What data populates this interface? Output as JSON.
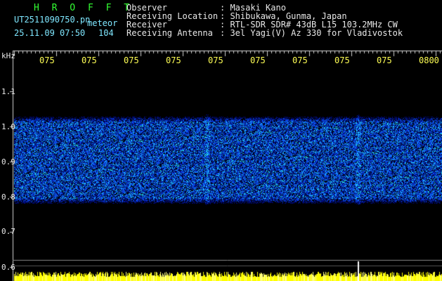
{
  "header": {
    "title": "H R O F F T",
    "filename": "UT2511090750.pn",
    "tag": "meteor",
    "datetime": "25.11.09 07:50",
    "count": "104",
    "info_labels": [
      "Observer",
      "Receiving Location",
      "Receiver",
      "Receiving Antenna"
    ],
    "info_values": [
      ": Masaki Kano",
      ": Shibukawa, Gunma, Japan",
      ": RTL-SDR SDR# 43dB L15 103.2MHz CW",
      ": 3el Yagi(V) Az 330 for Vladivostok"
    ]
  },
  "y_axis": {
    "unit": "kHz",
    "ticks": [
      "1.1",
      "1.0",
      "0.9",
      "0.8",
      "0.7",
      "0.6"
    ]
  },
  "time_axis": {
    "ticks": [
      "075",
      "075",
      "075",
      "075",
      "075",
      "075",
      "075",
      "075",
      "075",
      "0800"
    ]
  },
  "colors": {
    "background": "#000000",
    "signal_blue": "#0a3cff",
    "signal_cyan": "#22e0ff",
    "baseline_yellow": "#ffff00",
    "title_green": "#33ff33"
  }
}
